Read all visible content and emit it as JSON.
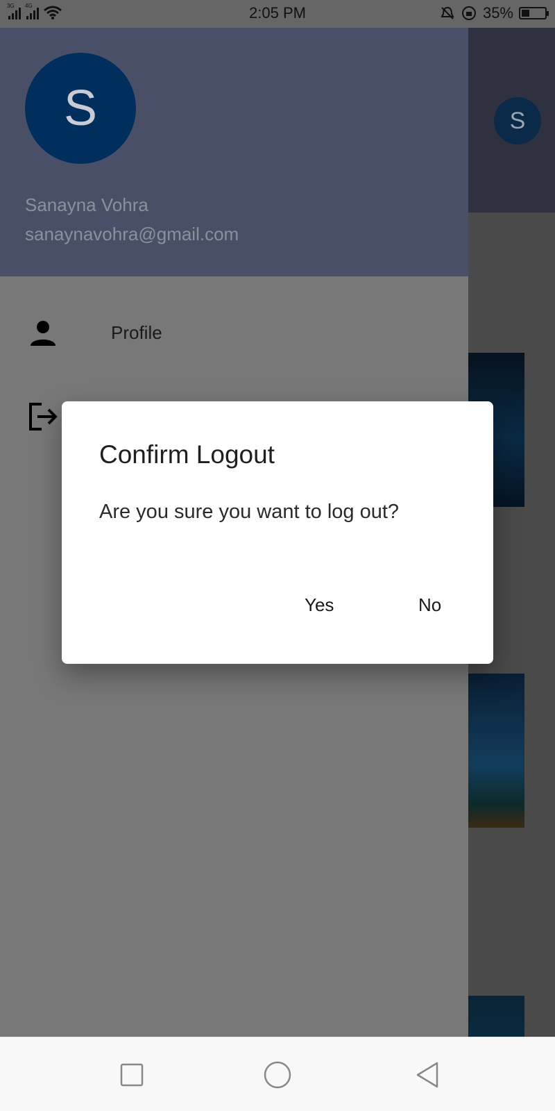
{
  "status_bar": {
    "time": "2:05 PM",
    "network_1": "3G",
    "network_2": "4G",
    "battery_percent": "35%",
    "battery_level": 0.35,
    "icons": [
      "signal-icon",
      "wifi-icon",
      "notifications-off-icon",
      "alarm-icon",
      "battery-icon"
    ]
  },
  "drawer": {
    "avatar_initial": "S",
    "user_name": "Sanayna Vohra",
    "user_email": "sanaynavohra@gmail.com",
    "items": [
      {
        "label": "Profile",
        "icon": "person-icon"
      },
      {
        "label": "",
        "icon": "logout-icon"
      }
    ],
    "header_color": "#4a4f68",
    "avatar_color": "#002f5e"
  },
  "main_page": {
    "avatar_initial": "S"
  },
  "dialog": {
    "title": "Confirm Logout",
    "message": "Are you sure you want to log out?",
    "yes_label": "Yes",
    "no_label": "No"
  },
  "nav_bar": {
    "icons": [
      "recents-icon",
      "home-icon",
      "back-icon"
    ]
  }
}
